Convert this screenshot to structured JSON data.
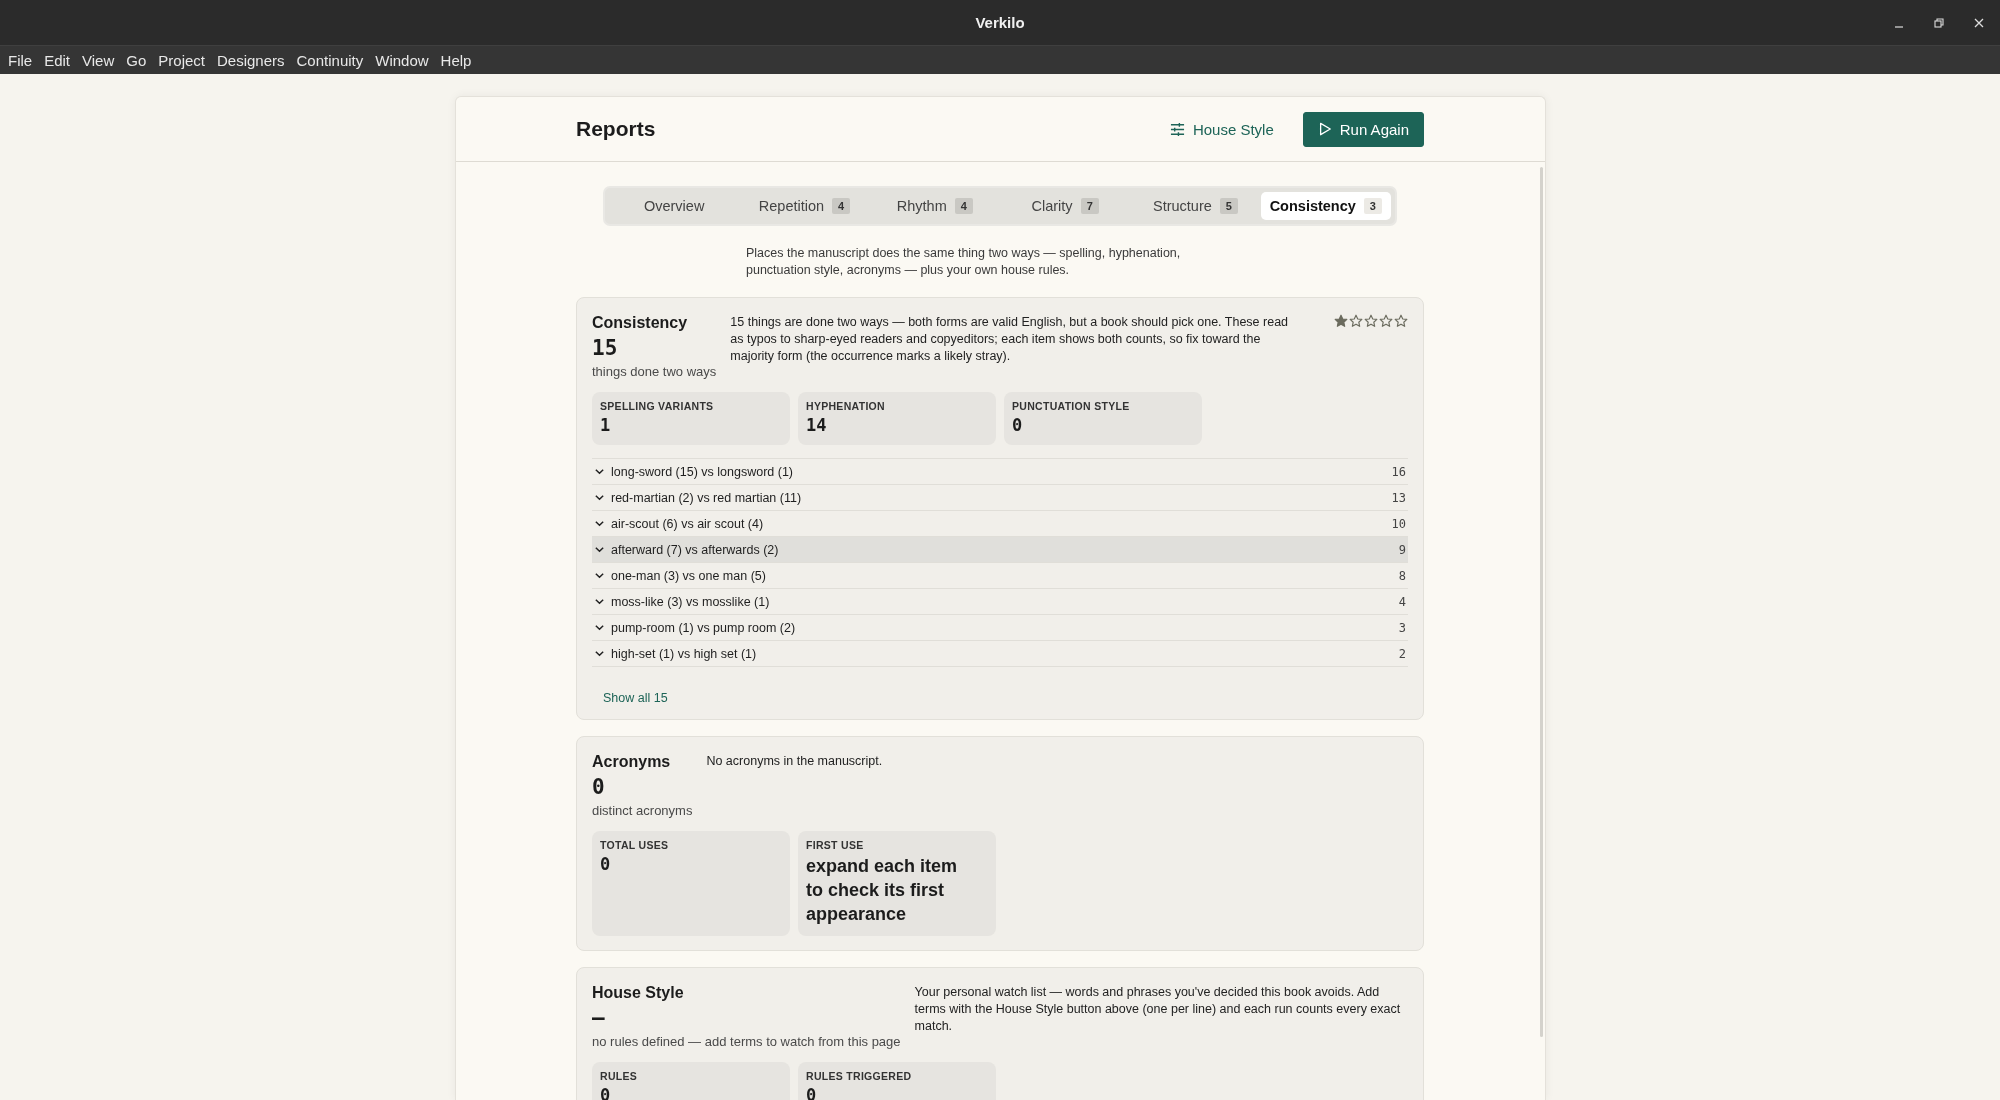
{
  "window": {
    "title": "Verkilo"
  },
  "menu": [
    "File",
    "Edit",
    "View",
    "Go",
    "Project",
    "Designers",
    "Continuity",
    "Window",
    "Help"
  ],
  "header": {
    "title": "Reports",
    "buttons": [
      {
        "label": "House Style",
        "kind": "ghost"
      },
      {
        "label": "Run Again",
        "kind": "primary"
      }
    ]
  },
  "tabs": [
    {
      "label": "Overview",
      "selected": false
    },
    {
      "label": "Repetition",
      "count": "4",
      "selected": false
    },
    {
      "label": "Rhythm",
      "count": "4",
      "selected": false
    },
    {
      "label": "Clarity",
      "count": "7",
      "selected": false
    },
    {
      "label": "Structure",
      "count": "5",
      "selected": false
    },
    {
      "label": "Consistency",
      "count": "3",
      "selected": true
    }
  ],
  "intro": "Places the manuscript does the same thing two ways — spelling, hyphenation, punctuation style, acronyms — plus your own house rules.",
  "sections": [
    {
      "title": "Consistency",
      "value": "15",
      "caption": "things done two ways",
      "description": "15 things are done two ways — both forms are valid English, but a book should pick one. These read as typos to sharp-eyed readers and copyeditors; each item shows both counts, so fix toward the majority form (the occurrence marks a likely stray).",
      "stars": 1,
      "stats": [
        {
          "label": "SPELLING VARIANTS",
          "value": "1"
        },
        {
          "label": "HYPHENATION",
          "value": "14"
        },
        {
          "label": "PUNCTUATION STYLE",
          "value": "0"
        }
      ],
      "items": [
        {
          "label": "long-sword (15) vs longsword (1)",
          "count": "16",
          "highlighted": false
        },
        {
          "label": "red-martian (2) vs red martian (11)",
          "count": "13",
          "highlighted": false
        },
        {
          "label": "air-scout (6) vs air scout (4)",
          "count": "10",
          "highlighted": false
        },
        {
          "label": "afterward (7) vs afterwards (2)",
          "count": "9",
          "highlighted": true
        },
        {
          "label": "one-man (3) vs one man (5)",
          "count": "8",
          "highlighted": false
        },
        {
          "label": "moss-like (3) vs mosslike (1)",
          "count": "4",
          "highlighted": false
        },
        {
          "label": "pump-room (1) vs pump room (2)",
          "count": "3",
          "highlighted": false
        },
        {
          "label": "high-set (1) vs high set (1)",
          "count": "2",
          "highlighted": false
        }
      ],
      "more_link": "Show all 15"
    },
    {
      "title": "Acronyms",
      "value": "0",
      "caption": "distinct acronyms",
      "description": "No acronyms in the manuscript.",
      "stats": [
        {
          "label": "TOTAL USES",
          "value": "0"
        },
        {
          "label": "FIRST USE",
          "value": "expand each item to check its first appearance"
        }
      ]
    },
    {
      "title": "House Style",
      "value": "—",
      "caption": "no rules defined — add terms to watch from this page",
      "description": "Your personal watch list — words and phrases you've decided this book avoids. Add terms with the House Style button above (one per line) and each run counts every exact match.",
      "stats": [
        {
          "label": "RULES",
          "value": "0"
        },
        {
          "label": "RULES TRIGGERED",
          "value": "0"
        }
      ]
    }
  ]
}
